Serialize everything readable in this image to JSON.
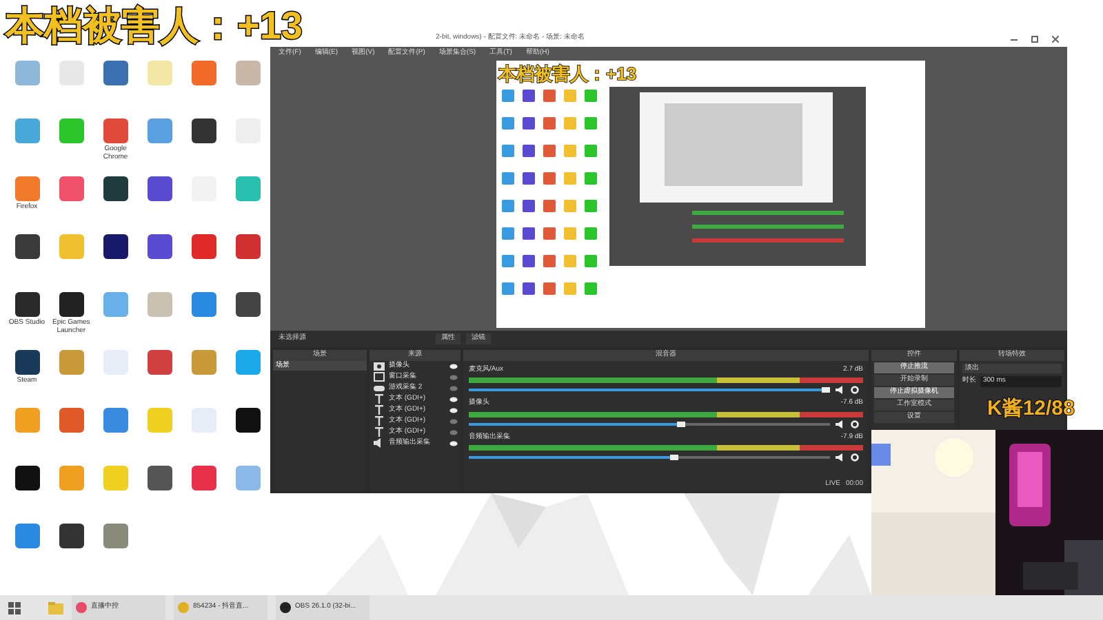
{
  "overlay_title": "本档被害人：+13",
  "overlay_counter": "K酱12/88",
  "desktop_icons": [
    {
      "color": "#8fb8d8"
    },
    {
      "color": "#e8e8e8"
    },
    {
      "color": "#3a6fb0"
    },
    {
      "color": "#f3e7a8"
    },
    {
      "color": "#f26b2a"
    },
    {
      "color": "#c9b8a8"
    },
    {
      "color": "#4aa8d8"
    },
    {
      "color": "#2bc42b"
    },
    {
      "label": "Google Chrome",
      "color": "#e04a3a"
    },
    {
      "color": "#5aa0e0"
    },
    {
      "color": "#333333"
    },
    {
      "color": "#eeeeee"
    },
    {
      "label": "Firefox",
      "color": "#f07a2a"
    },
    {
      "color": "#f0506a"
    },
    {
      "color": "#1f3b3b"
    },
    {
      "color": "#5a4ad0"
    },
    {
      "color": "#f2f2f2"
    },
    {
      "color": "#2ac0b0"
    },
    {
      "color": "#3a3a3a"
    },
    {
      "color": "#f0c030"
    },
    {
      "color": "#1a1a6a"
    },
    {
      "color": "#5a4ad0"
    },
    {
      "color": "#e02a2a"
    },
    {
      "color": "#d03030"
    },
    {
      "label": "OBS Studio",
      "color": "#2a2a2a"
    },
    {
      "label": "Epic Games Launcher",
      "color": "#222222"
    },
    {
      "color": "#6ab0e8"
    },
    {
      "color": "#c8c0b0"
    },
    {
      "color": "#2a8ae0"
    },
    {
      "color": "#444444"
    },
    {
      "label": "Steam",
      "color": "#1b3a5a"
    },
    {
      "color": "#c89a3a"
    },
    {
      "color": "#e8eef8"
    },
    {
      "color": "#d04040"
    },
    {
      "color": "#c89a3a"
    },
    {
      "color": "#1aa8e8"
    },
    {
      "color": "#f0a020"
    },
    {
      "color": "#e05a2a"
    },
    {
      "color": "#3a8ae0"
    },
    {
      "color": "#f0d020"
    },
    {
      "color": "#e8eef8"
    },
    {
      "color": "#111111"
    },
    {
      "color": "#111111"
    },
    {
      "color": "#f0a020"
    },
    {
      "color": "#f0d020"
    },
    {
      "color": "#555555"
    },
    {
      "color": "#e8304a"
    },
    {
      "color": "#8ab8e8"
    },
    {
      "color": "#2a8ae0"
    },
    {
      "color": "#333333"
    },
    {
      "color": "#8a8a7a"
    }
  ],
  "obs": {
    "title": "2-bit, windows) - 配置文件: 未命名 - 场景: 未命名",
    "menu": [
      "文件(F)",
      "编辑(E)",
      "视图(V)",
      "配置文件(P)",
      "场景集合(S)",
      "工具(T)",
      "帮助(H)"
    ],
    "preview": {
      "title": "本档被害人：+13"
    },
    "source_bar": {
      "label": "未选择源",
      "buttons": [
        "属性",
        "滤镜"
      ]
    },
    "scenes": {
      "title": "场景",
      "items": [
        {
          "label": "场景",
          "selected": true
        }
      ]
    },
    "sources": {
      "title": "来源",
      "items": [
        {
          "kind": "camera",
          "label": "摄像头",
          "visible": true
        },
        {
          "kind": "window",
          "label": "窗口采集",
          "visible": false
        },
        {
          "kind": "game",
          "label": "游戏采集 2",
          "visible": false
        },
        {
          "kind": "text",
          "label": "文本 (GDI+)",
          "visible": true
        },
        {
          "kind": "text",
          "label": "文本 (GDI+)",
          "visible": true
        },
        {
          "kind": "text",
          "label": "文本 (GDI+)",
          "visible": false
        },
        {
          "kind": "text",
          "label": "文本 (GDI+)",
          "visible": false
        },
        {
          "kind": "audio",
          "label": "音频输出采集",
          "visible": true
        }
      ]
    },
    "mixer": {
      "title": "混音器",
      "channels": [
        {
          "name": "麦克风/Aux",
          "reading": "2.7 dB",
          "level": 1.0
        },
        {
          "name": "摄像头",
          "reading": "-7.6 dB",
          "level": 0.6
        },
        {
          "name": "音频输出采集",
          "reading": "-7.9 dB",
          "level": 0.58
        }
      ]
    },
    "status": {
      "live": "LIVE",
      "time": "00:00"
    },
    "controls": {
      "title": "控件",
      "buttons": [
        {
          "label": "停止推流",
          "selected": true
        },
        {
          "label": "开始录制",
          "selected": false
        },
        {
          "label": "停止虚拟摄像机",
          "selected": true
        },
        {
          "label": "工作室模式",
          "selected": false
        },
        {
          "label": "设置",
          "selected": false
        }
      ]
    },
    "transitions": {
      "title": "转场特效",
      "select": "淡出",
      "duration_label": "时长",
      "duration": "300 ms"
    }
  },
  "taskbar": [
    {
      "label": "直播中控",
      "color": "#e84a6a"
    },
    {
      "label": "854234 - 抖音直...",
      "color": "#e0b020"
    },
    {
      "label": "OBS 26.1.0 (32-bi...",
      "color": "#222222"
    }
  ]
}
